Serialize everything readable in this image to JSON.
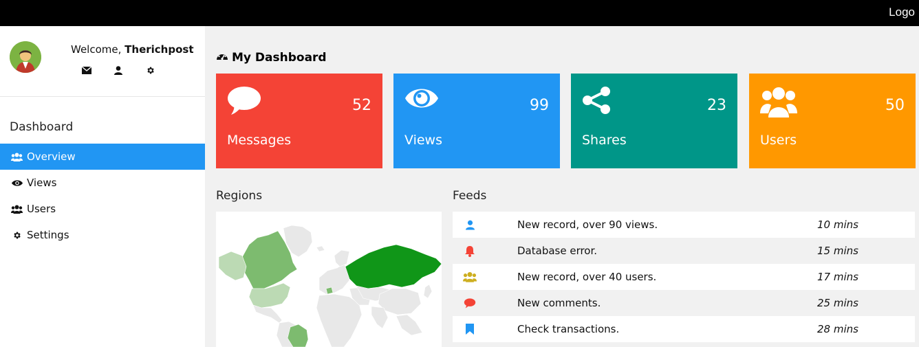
{
  "topbar": {
    "logo": "Logo"
  },
  "user": {
    "welcome_prefix": "Welcome, ",
    "name": "Therichpost"
  },
  "user_icons": [
    "envelope-icon",
    "user-icon",
    "gear-icon"
  ],
  "sidebar": {
    "heading": "Dashboard",
    "items": [
      {
        "label": "Overview",
        "icon": "users-icon",
        "active": true
      },
      {
        "label": "Views",
        "icon": "eye-icon",
        "active": false
      },
      {
        "label": "Users",
        "icon": "users-icon",
        "active": false
      },
      {
        "label": "Settings",
        "icon": "gear-icon",
        "active": false
      }
    ]
  },
  "dashboard": {
    "title": "My Dashboard"
  },
  "cards": [
    {
      "label": "Messages",
      "value": "52",
      "icon": "comment-icon",
      "color": "#f44336"
    },
    {
      "label": "Views",
      "value": "99",
      "icon": "eye-icon",
      "color": "#2196f3"
    },
    {
      "label": "Shares",
      "value": "23",
      "icon": "share-icon",
      "color": "#009688"
    },
    {
      "label": "Users",
      "value": "50",
      "icon": "users-icon",
      "color": "#ff9800"
    }
  ],
  "regions": {
    "label": "Regions"
  },
  "feeds": {
    "label": "Feeds",
    "rows": [
      {
        "text": "New record, over 90 views.",
        "time": "10 mins",
        "icon": "user-icon",
        "icon_color": "#2196f3"
      },
      {
        "text": "Database error.",
        "time": "15 mins",
        "icon": "bell-icon",
        "icon_color": "#f44336"
      },
      {
        "text": "New record, over 40 users.",
        "time": "17 mins",
        "icon": "users-icon",
        "icon_color": "#cdae1f"
      },
      {
        "text": "New comments.",
        "time": "25 mins",
        "icon": "comment-icon",
        "icon_color": "#f44336"
      },
      {
        "text": "Check transactions.",
        "time": "28 mins",
        "icon": "bookmark-icon",
        "icon_color": "#2196f3"
      }
    ]
  }
}
